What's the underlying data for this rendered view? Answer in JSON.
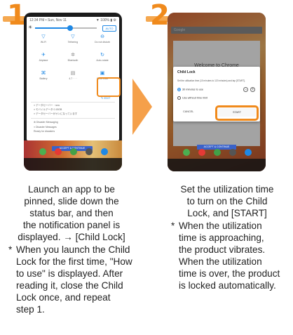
{
  "steps": [
    {
      "number": "1",
      "caption_lines": [
        "Launch an app to be",
        "pinned, slide down the",
        "status bar, and then",
        "the notification panel is",
        "displayed. → [Child Lock]"
      ],
      "note_lines": [
        "When you launch the Child",
        "Lock for the first time, \"How",
        "to use\" is displayed. After",
        "reading it, close the Child",
        "Lock once, and repeat",
        "step 1."
      ]
    },
    {
      "number": "2",
      "caption_lines": [
        "Set the utilization time",
        "to turn on the Child",
        "Lock, and [START]"
      ],
      "note_lines": [
        "When the utilization",
        "time is approaching,",
        "the product vibrates.",
        "When the utilization",
        "time is over, the product",
        "is locked automatically."
      ]
    }
  ],
  "note_mark": "*",
  "phone1": {
    "status_time": "12:34 PM • Sun, Nov 11",
    "status_icons": "▼ 100% ▮ ⚙",
    "auto_label": "AUTO",
    "tiles": [
      {
        "icon": "wifi-icon",
        "glyph": "▽",
        "label": "Wi-Fi"
      },
      {
        "icon": "tethering-icon",
        "glyph": "▽",
        "label": "Tethering"
      },
      {
        "icon": "do-not-disturb-icon",
        "glyph": "⊖",
        "label": "Do not disturb"
      },
      {
        "icon": "airplane-icon",
        "glyph": "✈",
        "label": "Airplane"
      },
      {
        "icon": "bluetooth-icon",
        "glyph": "✲",
        "label": "Bluetooth"
      },
      {
        "icon": "rotate-icon",
        "glyph": "↻",
        "label": "Auto-rotate"
      },
      {
        "icon": "battery-icon",
        "glyph": "⌘",
        "label": "Battery"
      },
      {
        "icon": "data-icon",
        "glyph": "▤",
        "label": "4.7 · · ·"
      },
      {
        "icon": "child-lock-icon",
        "glyph": "▣",
        "label": "Child Lock"
      }
    ],
    "edit_label": "✎ EDIT",
    "notif_lines": [
      "≡ データセーバー · now",
      "≡ モバイルデータ 0.15GB",
      "≡ データセーバーがオンになっています"
    ],
    "notif2_lines": [
      "⊕ Disaster Messaging",
      "≡ Disaster Messages",
      "Ready for disasters"
    ],
    "get_started": "ACCEPT & CONTINUE"
  },
  "phone2": {
    "search_text": "Google",
    "welcome": "Welcome to Chrome",
    "dialog_title": "Child Lock",
    "dialog_desc": "Set the utilization time (10 minutes to 120 minutes) and tap [START].",
    "option1": "30 minutes to use",
    "option2": "Use without time limit",
    "cancel": "CANCEL",
    "start": "START",
    "accept": "ACCEPT & CONTINUE"
  },
  "colors": {
    "accent": "#f08a1c",
    "blue": "#1e88e5"
  }
}
